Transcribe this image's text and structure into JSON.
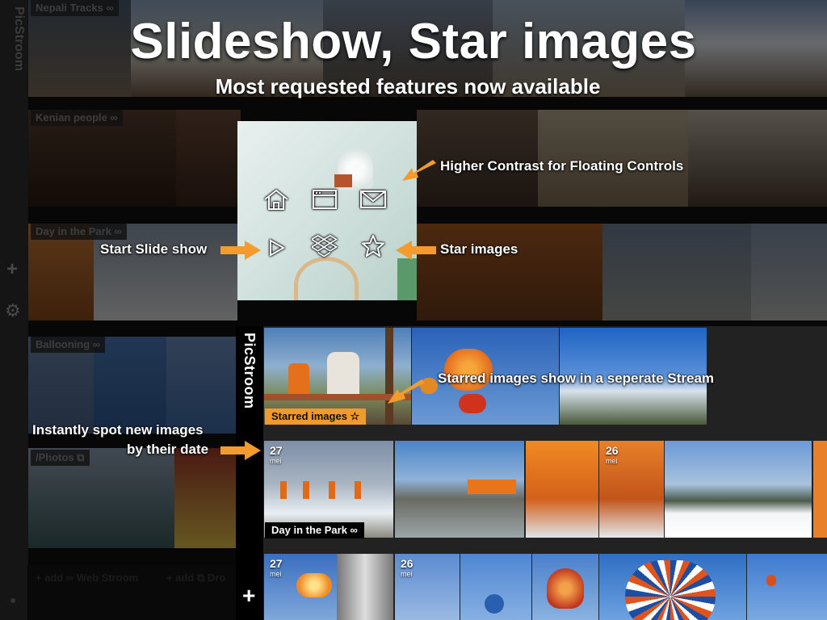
{
  "headline": "Slideshow, Star images",
  "subhead": "Most requested features now available",
  "background_app": {
    "logo": "PicStroom",
    "streams": [
      {
        "label": "Nepali Tracks ∞"
      },
      {
        "label": "Kenian people ∞"
      },
      {
        "label": "Day in the Park ∞"
      },
      {
        "label": "Ballooning ∞"
      },
      {
        "label": "/Photos"
      }
    ],
    "add_web_stream": "+ add ∞ Web Stroom",
    "add_dropbox": "+ add",
    "add_dropbox_tail": "Dro"
  },
  "controls": {
    "icons": [
      "home-icon",
      "browser-window-icon",
      "mail-icon",
      "play-icon",
      "dropbox-icon",
      "star-icon"
    ]
  },
  "annotations": {
    "higher_contrast": "Higher Contrast for Floating Controls",
    "start_slideshow": "Start Slide show",
    "star_images": "Star images",
    "starred_stream": "Starred images show in a seperate Stream",
    "spot_new_line1": "Instantly spot new images",
    "spot_new_line2": "by their date"
  },
  "foreground_app": {
    "logo": "PicStroom",
    "starred_label": "Starred images ☆",
    "park_label": "Day in the Park ∞",
    "date_badges": [
      {
        "day": "27",
        "month": "mei"
      },
      {
        "day": "26",
        "month": "mei"
      },
      {
        "day": "27",
        "month": "mei"
      },
      {
        "day": "26",
        "month": "mei"
      }
    ],
    "add_label": "+"
  },
  "colors": {
    "accent_orange": "#f39b2c",
    "starred_label_bg": "#ee9a2c",
    "background": "#111111"
  }
}
